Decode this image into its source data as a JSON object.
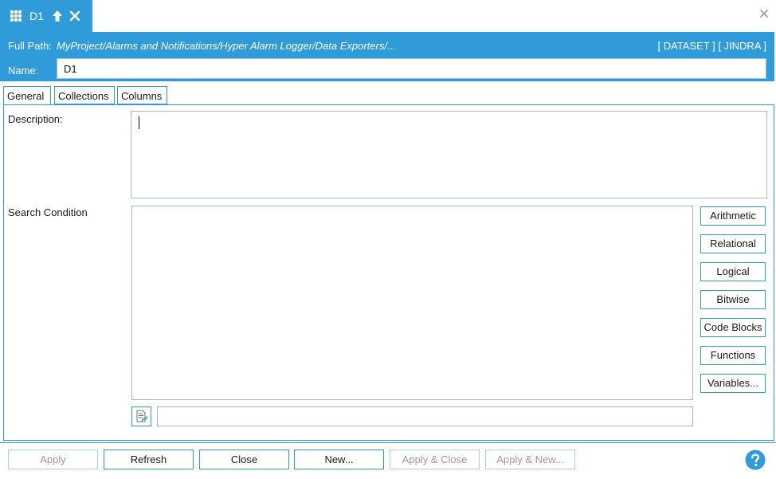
{
  "tab": {
    "title": "D1"
  },
  "header": {
    "full_path_label": "Full Path:",
    "full_path_value": "MyProject/Alarms and Notifications/Hyper Alarm Logger/Data Exporters/...",
    "tag": "[ DATASET ] [ JINDRA ]",
    "name_label": "Name:",
    "name_value": "D1"
  },
  "tabs": [
    "General",
    "Collections",
    "Columns"
  ],
  "form": {
    "description_label": "Description:",
    "search_condition_label": "Search Condition"
  },
  "side_buttons": [
    "Arithmetic",
    "Relational",
    "Logical",
    "Bitwise",
    "Code Blocks",
    "Functions",
    "Variables..."
  ],
  "footer": {
    "apply": "Apply",
    "refresh": "Refresh",
    "close": "Close",
    "new": "New...",
    "apply_close": "Apply & Close",
    "apply_new": "Apply & New..."
  },
  "colors": {
    "accent": "#2f9bd8",
    "disabled_text": "#9a9a9a"
  },
  "icons": [
    "grid-icon",
    "move-up-icon",
    "close-icon",
    "window-close-icon",
    "edit-expression-icon",
    "help-icon"
  ]
}
